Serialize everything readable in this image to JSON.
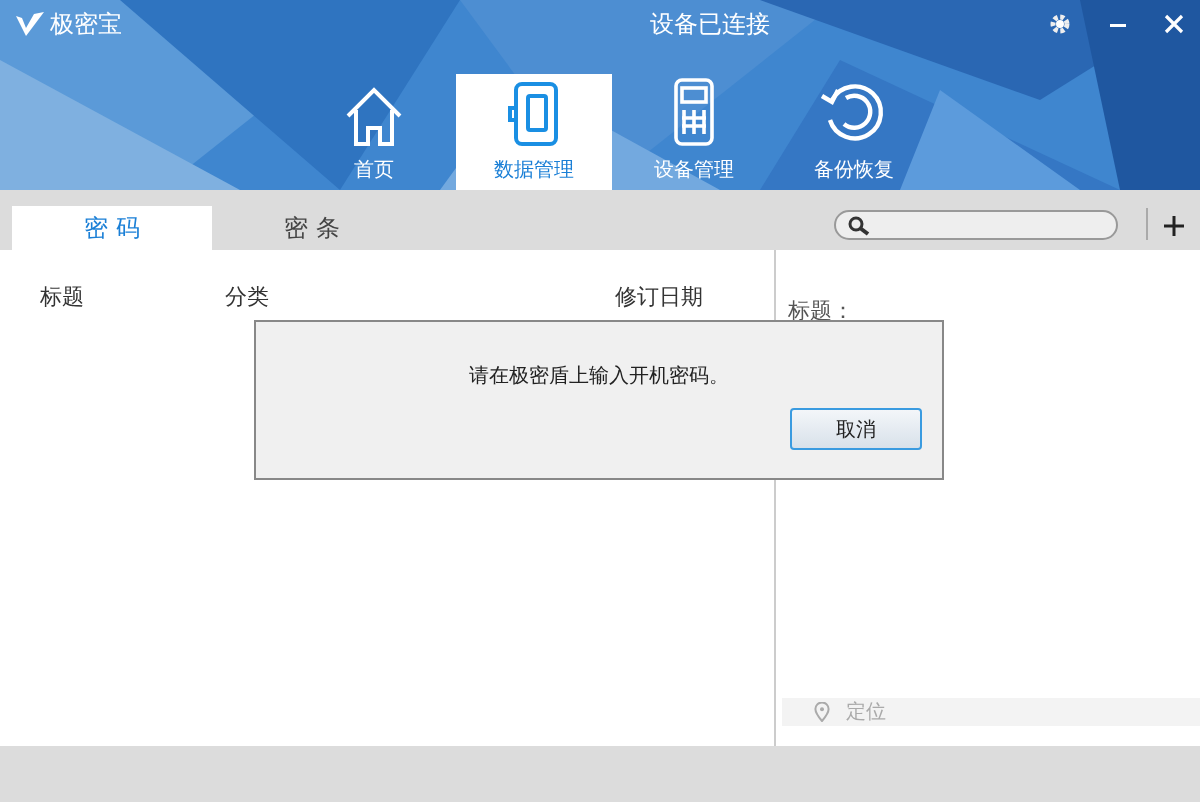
{
  "app": {
    "name": "极密宝"
  },
  "window": {
    "title": "设备已连接"
  },
  "nav_tabs": [
    {
      "label": "首页",
      "selected": false
    },
    {
      "label": "数据管理",
      "selected": true
    },
    {
      "label": "设备管理",
      "selected": false
    },
    {
      "label": "备份恢复",
      "selected": false
    }
  ],
  "sub_tabs": [
    {
      "label": "密 码",
      "selected": true
    },
    {
      "label": "密 条",
      "selected": false
    }
  ],
  "table": {
    "columns": [
      "标题",
      "分类",
      "修订日期"
    ]
  },
  "detail": {
    "field_label": "标题：",
    "location": "定位"
  },
  "dialog": {
    "message": "请在极密盾上输入开机密码。",
    "buttons": [
      "取消"
    ]
  }
}
